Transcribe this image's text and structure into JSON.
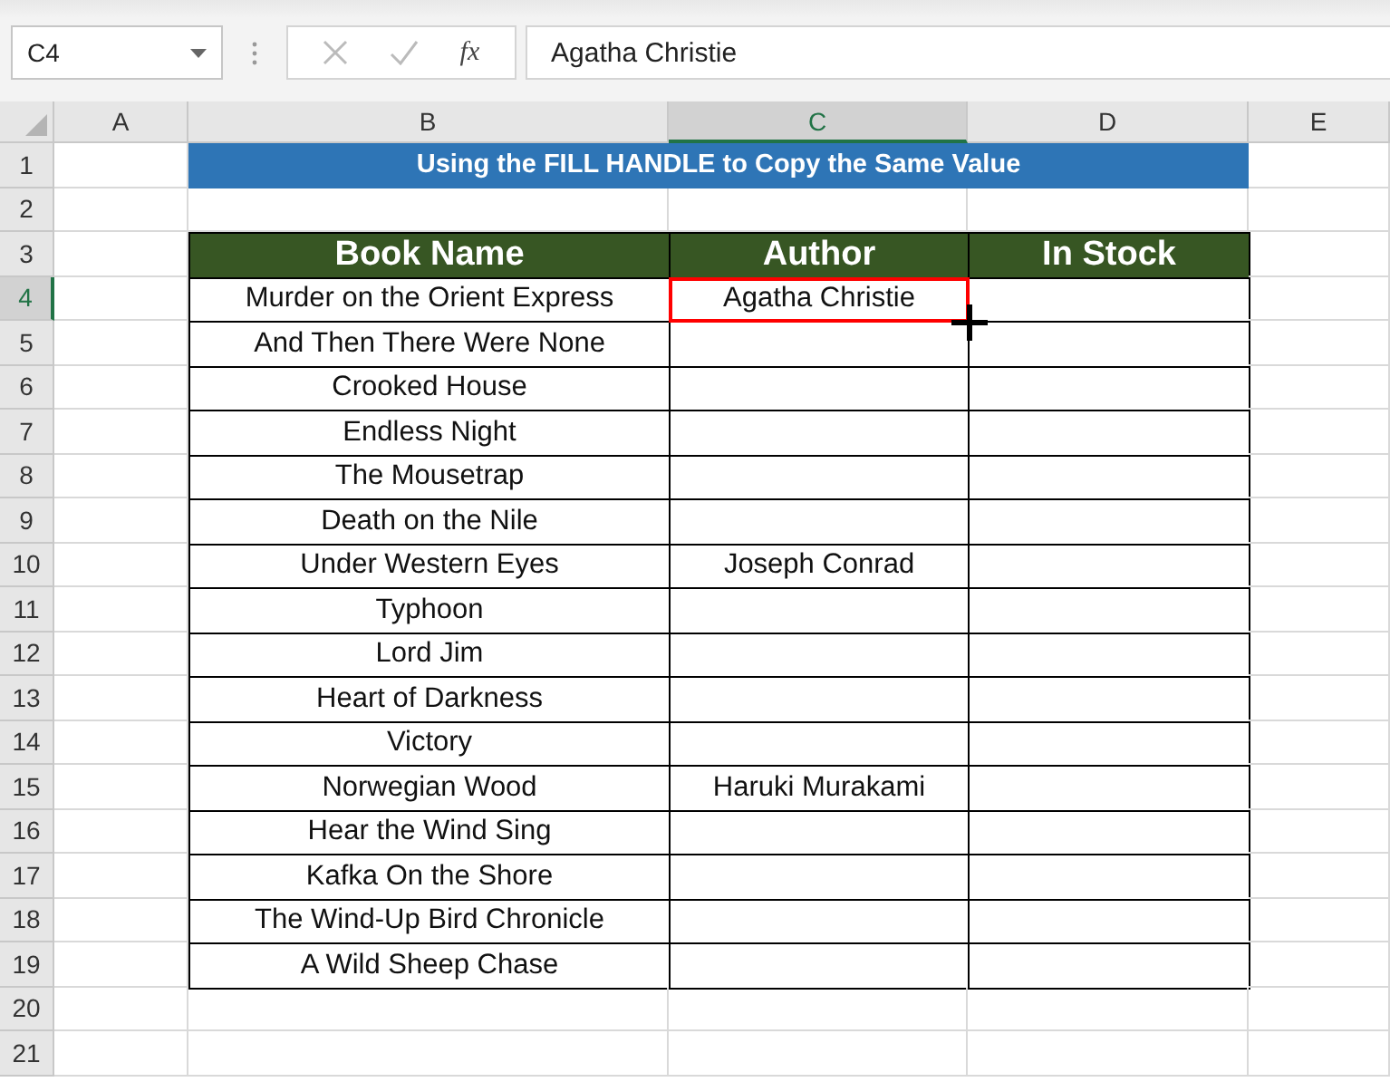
{
  "name_box": {
    "value": "C4"
  },
  "formula_bar": {
    "function_label": "fx",
    "value": "Agatha Christie"
  },
  "column_headers": [
    {
      "label": "A",
      "selected": false
    },
    {
      "label": "B",
      "selected": false
    },
    {
      "label": "C",
      "selected": true
    },
    {
      "label": "D",
      "selected": false
    },
    {
      "label": "E",
      "selected": false
    }
  ],
  "row_headers": [
    {
      "label": "1",
      "selected": false
    },
    {
      "label": "2",
      "selected": false
    },
    {
      "label": "3",
      "selected": false
    },
    {
      "label": "4",
      "selected": true
    },
    {
      "label": "5",
      "selected": false
    },
    {
      "label": "6",
      "selected": false
    },
    {
      "label": "7",
      "selected": false
    },
    {
      "label": "8",
      "selected": false
    },
    {
      "label": "9",
      "selected": false
    },
    {
      "label": "10",
      "selected": false
    },
    {
      "label": "11",
      "selected": false
    },
    {
      "label": "12",
      "selected": false
    },
    {
      "label": "13",
      "selected": false
    },
    {
      "label": "14",
      "selected": false
    },
    {
      "label": "15",
      "selected": false
    },
    {
      "label": "16",
      "selected": false
    },
    {
      "label": "17",
      "selected": false
    },
    {
      "label": "18",
      "selected": false
    },
    {
      "label": "19",
      "selected": false
    },
    {
      "label": "20",
      "selected": false
    },
    {
      "label": "21",
      "selected": false
    }
  ],
  "title": "Using the FILL HANDLE to Copy the Same Value",
  "table": {
    "columns": [
      "Book Name",
      "Author",
      "In Stock"
    ],
    "rows": [
      {
        "book_name": "Murder on the Orient Express",
        "author": {
          "text": "Agatha Christie",
          "selected": true
        }
      },
      {
        "book_name": "And Then There Were None"
      },
      {
        "book_name": "Crooked House"
      },
      {
        "book_name": "Endless Night"
      },
      {
        "book_name": "The Mousetrap"
      },
      {
        "book_name": "Death on the Nile"
      },
      {
        "book_name": "Under Western Eyes",
        "author": {
          "text": "Joseph Conrad",
          "selected": false
        }
      },
      {
        "book_name": "Typhoon"
      },
      {
        "book_name": "Lord Jim"
      },
      {
        "book_name": "Heart of Darkness"
      },
      {
        "book_name": "Victory"
      },
      {
        "book_name": "Norwegian Wood",
        "author": {
          "text": "Haruki Murakami",
          "selected": false
        }
      },
      {
        "book_name": "Hear the Wind Sing"
      },
      {
        "book_name": "Kafka On the Shore"
      },
      {
        "book_name": "The Wind-Up Bird Chronicle"
      },
      {
        "book_name": "A Wild Sheep Chase"
      }
    ]
  }
}
